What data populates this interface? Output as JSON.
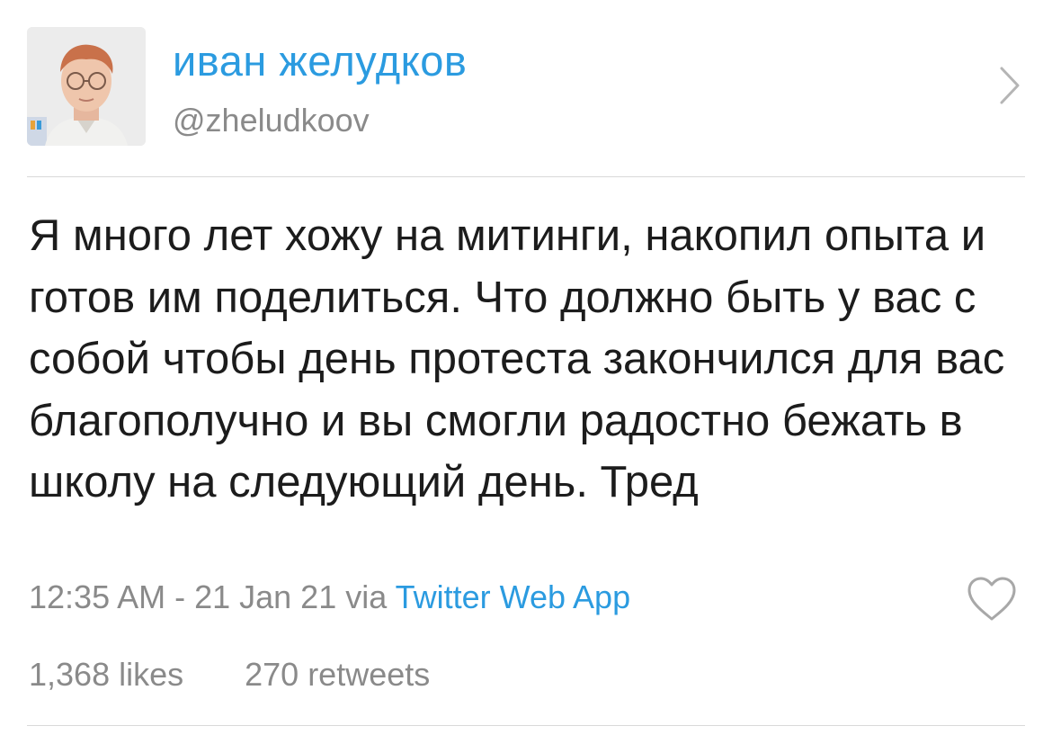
{
  "user": {
    "display_name": "иван желудков",
    "handle": "@zheludkoov"
  },
  "tweet": {
    "text": "Я много лет хожу на митинги, накопил опыта и готов им поделиться. Что должно быть у вас с собой чтобы день протеста закончился для вас благополучно и вы смогли радостно бежать в школу на следующий день. Тред",
    "timestamp": "12:35 AM - 21 Jan 21",
    "via_label": "via",
    "source": "Twitter Web App"
  },
  "stats": {
    "likes": "1,368 likes",
    "retweets": "270 retweets"
  },
  "icons": {
    "chevron": "chevron-right-icon",
    "like": "heart-outline-icon"
  },
  "colors": {
    "accent": "#2b9be0",
    "secondary_text": "#8a8a8a",
    "divider": "#d9d9d9"
  }
}
